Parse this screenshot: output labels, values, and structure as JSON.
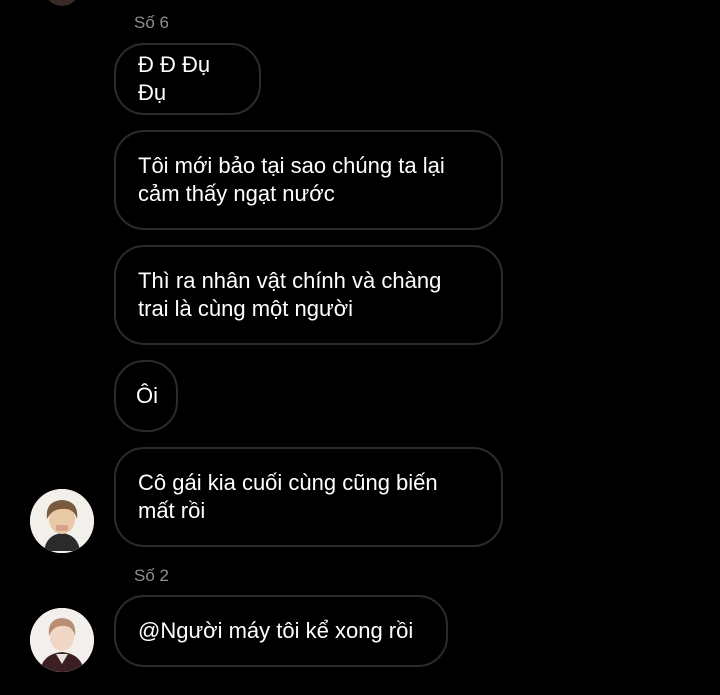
{
  "messages": [
    {
      "sender": "Số 6",
      "text": "Đ Đ Đụ Đụ"
    },
    {
      "text": "Tôi mới bảo tại sao chúng ta lại\ncảm thấy ngạt nước"
    },
    {
      "text": "Thì ra nhân vật chính và chàng\ntrai là cùng một người"
    },
    {
      "text": "Ôi"
    },
    {
      "text": "Cô gái kia cuối cùng cũng biến\nmất rồi"
    },
    {
      "sender": "Số 2",
      "text": "@Người máy tôi kể xong rồi"
    }
  ],
  "colors": {
    "background": "#000000",
    "bubble_border": "#2b2b2b",
    "sender_name": "#8e8e8e",
    "text": "#ffffff"
  }
}
